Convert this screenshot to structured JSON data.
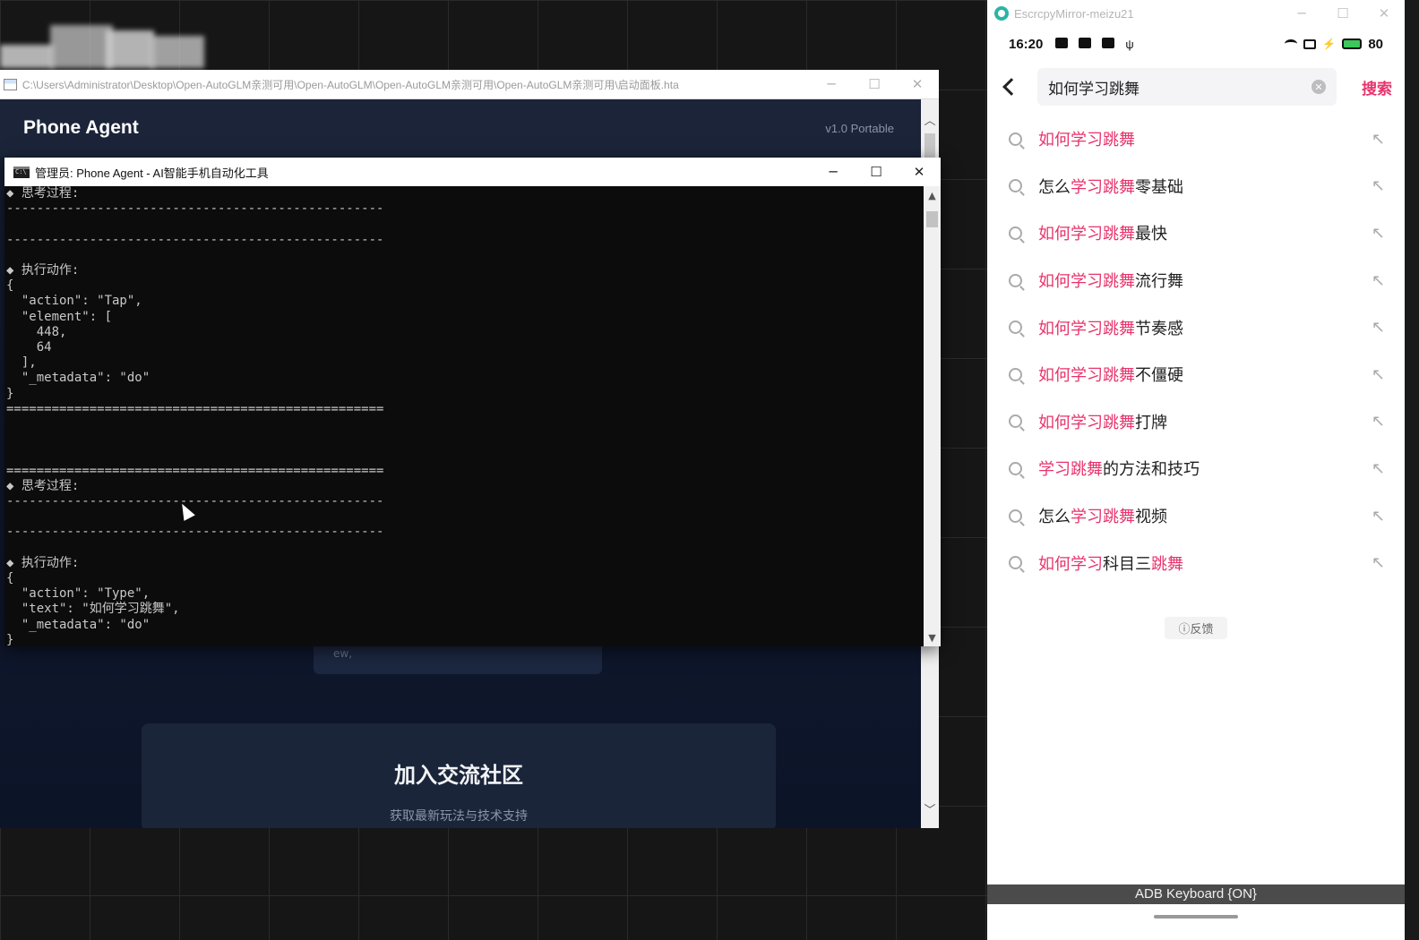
{
  "hta": {
    "path": "C:\\Users\\Administrator\\Desktop\\Open-AutoGLM亲测可用\\Open-AutoGLM\\Open-AutoGLM亲测可用\\Open-AutoGLM亲测可用\\启动面板.hta",
    "title": "Phone Agent",
    "version": "v1.0 Portable",
    "small_card_text": "ew,",
    "community_title": "加入交流社区",
    "community_sub": "获取最新玩法与技术支持"
  },
  "console": {
    "title": "管理员:  Phone Agent - AI智能手机自动化工具",
    "lines": [
      "◆ 思考过程:",
      "--------------------------------------------------",
      "",
      "--------------------------------------------------",
      "",
      "◆ 执行动作:",
      "{",
      "  \"action\": \"Tap\",",
      "  \"element\": [",
      "    448,",
      "    64",
      "  ],",
      "  \"_metadata\": \"do\"",
      "}",
      "==================================================",
      "",
      "",
      "",
      "==================================================",
      "◆ 思考过程:",
      "--------------------------------------------------",
      "",
      "--------------------------------------------------",
      "",
      "◆ 执行动作:",
      "{",
      "  \"action\": \"Type\",",
      "  \"text\": \"如何学习跳舞\",",
      "  \"_metadata\": \"do\"",
      "}",
      "=================================================="
    ]
  },
  "phone": {
    "window_title": "EscrcpyMirror-meizu21",
    "time": "16:20",
    "battery": "80",
    "search_value": "如何学习跳舞",
    "search_button": "搜索",
    "highlight_color": "#e8336d",
    "suggestions": [
      {
        "pre": "",
        "hl": "如何学习跳舞",
        "post": ""
      },
      {
        "pre": "怎么",
        "hl": "学习跳舞",
        "post": "零基础"
      },
      {
        "pre": "",
        "hl": "如何学习跳舞",
        "post": "最快"
      },
      {
        "pre": "",
        "hl": "如何学习跳舞",
        "post": "流行舞"
      },
      {
        "pre": "",
        "hl": "如何学习跳舞",
        "post": "节奏感"
      },
      {
        "pre": "",
        "hl": "如何学习跳舞",
        "post": "不僵硬"
      },
      {
        "pre": "",
        "hl": "如何学习跳舞",
        "post": "打牌"
      },
      {
        "pre": "",
        "hl": "学习跳舞",
        "post": "的方法和技巧"
      },
      {
        "pre": "怎么",
        "hl": "学习跳舞",
        "post": "视频"
      },
      {
        "pre": "",
        "hl": "如何学习",
        "post": "科目三",
        "hl2": "跳舞"
      }
    ],
    "feedback": "ⓘ反馈",
    "adb_keyboard": "ADB Keyboard {ON}"
  }
}
